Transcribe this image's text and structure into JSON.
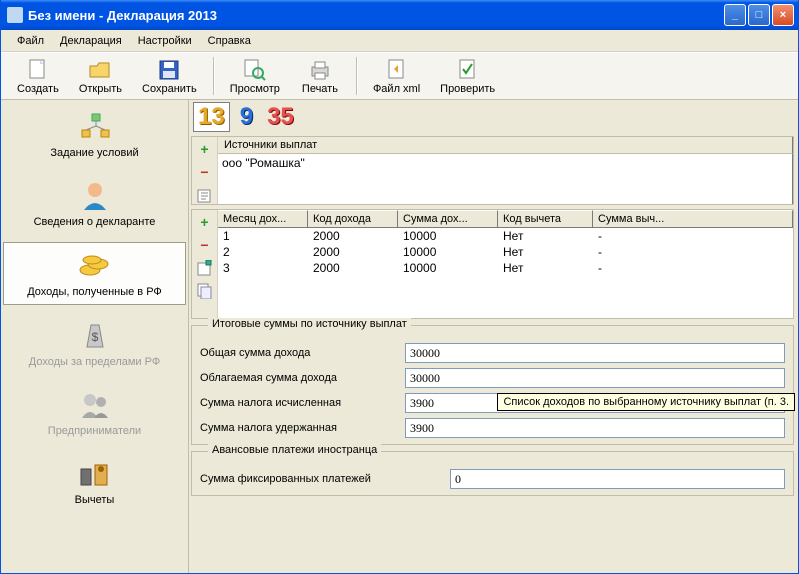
{
  "window": {
    "title": "Без имени - Декларация 2013"
  },
  "menu": {
    "file": "Файл",
    "decl": "Декларация",
    "settings": "Настройки",
    "help": "Справка"
  },
  "toolbar": {
    "create": "Создать",
    "open": "Открыть",
    "save": "Сохранить",
    "preview": "Просмотр",
    "print": "Печать",
    "xml": "Файл xml",
    "check": "Проверить"
  },
  "sidebar": {
    "items": [
      "Задание условий",
      "Сведения о декларанте",
      "Доходы, полученные в РФ",
      "Доходы за пределами РФ",
      "Предприниматели",
      "Вычеты"
    ]
  },
  "rates": {
    "r13": "13",
    "r9": "9",
    "r35": "35"
  },
  "sources": {
    "title": "Источники выплат",
    "list": [
      "ооо \"Ромашка\""
    ]
  },
  "grid": {
    "headers": [
      "Месяц дох...",
      "Код дохода",
      "Сумма дох...",
      "Код вычета",
      "Сумма выч..."
    ],
    "rows": [
      [
        "1",
        "2000",
        "10000",
        "Нет",
        "-"
      ],
      [
        "2",
        "2000",
        "10000",
        "Нет",
        "-"
      ],
      [
        "3",
        "2000",
        "10000",
        "Нет",
        "-"
      ]
    ]
  },
  "tooltip": "Список доходов по выбранному источнику выплат (п. 3.",
  "totals": {
    "title": "Итоговые суммы по источнику выплат",
    "total_label": "Общая сумма дохода",
    "total_val": "30000",
    "taxable_label": "Облагаемая сумма дохода",
    "taxable_val": "30000",
    "calc_label": "Сумма налога исчисленная",
    "calc_val": "3900",
    "withheld_label": "Сумма налога удержанная",
    "withheld_val": "3900"
  },
  "advance": {
    "title": "Авансовые платежи иностранца",
    "fixed_label": "Сумма фиксированных платежей",
    "fixed_val": "0"
  }
}
